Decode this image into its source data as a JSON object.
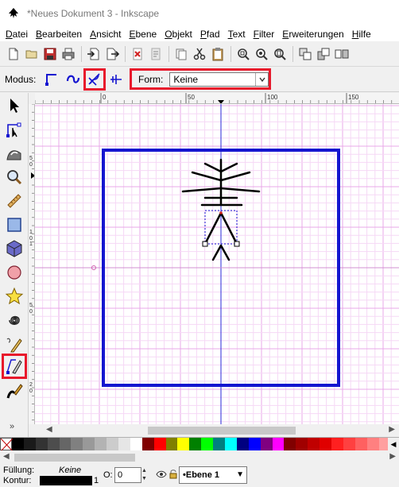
{
  "window": {
    "title": "*Neues Dokument 3 - Inkscape"
  },
  "menu": [
    {
      "label": "Datei",
      "u": "D",
      "rest": "atei"
    },
    {
      "label": "Bearbeiten",
      "u": "B",
      "rest": "earbeiten"
    },
    {
      "label": "Ansicht",
      "u": "A",
      "rest": "nsicht"
    },
    {
      "label": "Ebene",
      "u": "E",
      "rest": "bene"
    },
    {
      "label": "Objekt",
      "u": "O",
      "rest": "bjekt"
    },
    {
      "label": "Pfad",
      "u": "P",
      "rest": "fad"
    },
    {
      "label": "Text",
      "u": "T",
      "rest": "ext"
    },
    {
      "label": "Filter",
      "u": "F",
      "rest": "ilter"
    },
    {
      "label": "Erweiterungen",
      "u": "E",
      "rest": "rweiterungen"
    },
    {
      "label": "Hilfe",
      "u": "H",
      "rest": "ilfe"
    }
  ],
  "tool_controls": {
    "mode_label": "Modus:",
    "shape_label": "Form:",
    "shape_value": "Keine",
    "modes": [
      "bezier-mode-icon",
      "spiro-mode-icon",
      "bspline-mode-icon",
      "paraxial-mode-icon"
    ],
    "active_mode": "bspline-mode-icon"
  },
  "ruler": {
    "h_labels": [
      "0",
      "50",
      "100",
      "150"
    ],
    "v_labels": [
      "5",
      "0",
      "1",
      "0",
      "1",
      "5",
      "0",
      "2",
      "0"
    ]
  },
  "toolbox": {
    "tools": [
      "selector-tool-icon",
      "node-tool-icon",
      "tweak-tool-icon",
      "zoom-tool-icon",
      "measure-tool-icon",
      "rect-tool-icon",
      "box3d-tool-icon",
      "ellipse-tool-icon",
      "star-tool-icon",
      "spiral-tool-icon",
      "pencil-tool-icon",
      "pen-tool-icon",
      "calligraphy-tool-icon"
    ],
    "active_tool": "pen-tool-icon",
    "more": "»"
  },
  "palette": {
    "colors": [
      "#000000",
      "#1a1a1a",
      "#333333",
      "#4d4d4d",
      "#666666",
      "#808080",
      "#999999",
      "#b3b3b3",
      "#cccccc",
      "#e6e6e6",
      "#ffffff",
      "#800000",
      "#ff0000",
      "#808000",
      "#ffff00",
      "#008000",
      "#00ff00",
      "#008080",
      "#00ffff",
      "#000080",
      "#0000ff",
      "#800080",
      "#ff00ff",
      "#800000",
      "#a00000",
      "#c00000",
      "#e00000",
      "#ff2020",
      "#ff4040",
      "#ff6060",
      "#ff8080",
      "#ffa0a0"
    ]
  },
  "status": {
    "fill_label": "Füllung:",
    "fill_value": "Keine",
    "stroke_label": "Kontur:",
    "stroke_width": "1",
    "opacity_label": "O:",
    "opacity_value": "0",
    "layer": "•Ebene 1"
  },
  "colors": {
    "highlight": "#e8182b",
    "frame": "#1515d0",
    "grid": "#f0c8f0",
    "guide": "#2a2ad8"
  }
}
